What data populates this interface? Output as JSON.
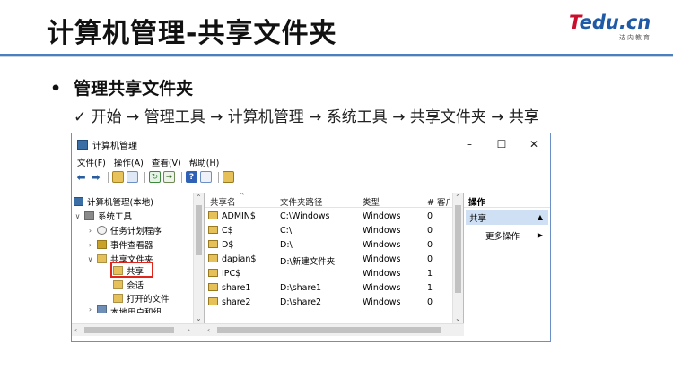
{
  "slide": {
    "title": "计算机管理-共享文件夹",
    "logo_text_red": "T",
    "logo_text_blue": "edu.cn",
    "logo_sub": "达内教育",
    "bullet": "管理共享文件夹",
    "subline": "✓ 开始 → 管理工具 → 计算机管理 → 系统工具 → 共享文件夹 → 共享"
  },
  "window": {
    "title": "计算机管理",
    "controls": {
      "minimize": "–",
      "maximize": "☐",
      "close": "✕"
    },
    "menu": [
      "文件(F)",
      "操作(A)",
      "查看(V)",
      "帮助(H)"
    ],
    "toolbar_icons": [
      "back-icon",
      "forward-icon",
      "up-folder-icon",
      "show-hide-tree-icon",
      "refresh-icon",
      "export-icon",
      "help-icon",
      "properties-icon",
      "new-share-icon"
    ],
    "tree": {
      "root": "计算机管理(本地)",
      "system_tools": "系统工具",
      "task_scheduler": "任务计划程序",
      "event_viewer": "事件查看器",
      "shared_folders": "共享文件夹",
      "shares": "共享",
      "sessions": "会话",
      "open_files": "打开的文件",
      "local_users": "本地用户和组"
    },
    "list": {
      "columns": [
        "共享名",
        "文件夹路径",
        "类型",
        "# 客户"
      ],
      "rows": [
        {
          "name": "ADMIN$",
          "path": "C:\\Windows",
          "type": "Windows",
          "clients": "0"
        },
        {
          "name": "C$",
          "path": "C:\\",
          "type": "Windows",
          "clients": "0"
        },
        {
          "name": "D$",
          "path": "D:\\",
          "type": "Windows",
          "clients": "0"
        },
        {
          "name": "dapian$",
          "path": "D:\\新建文件夹",
          "type": "Windows",
          "clients": "0"
        },
        {
          "name": "IPC$",
          "path": "",
          "type": "Windows",
          "clients": "1"
        },
        {
          "name": "share1",
          "path": "D:\\share1",
          "type": "Windows",
          "clients": "1"
        },
        {
          "name": "share2",
          "path": "D:\\share2",
          "type": "Windows",
          "clients": "0"
        }
      ]
    },
    "actions": {
      "header": "操作",
      "selected": "共享",
      "more": "更多操作"
    }
  }
}
